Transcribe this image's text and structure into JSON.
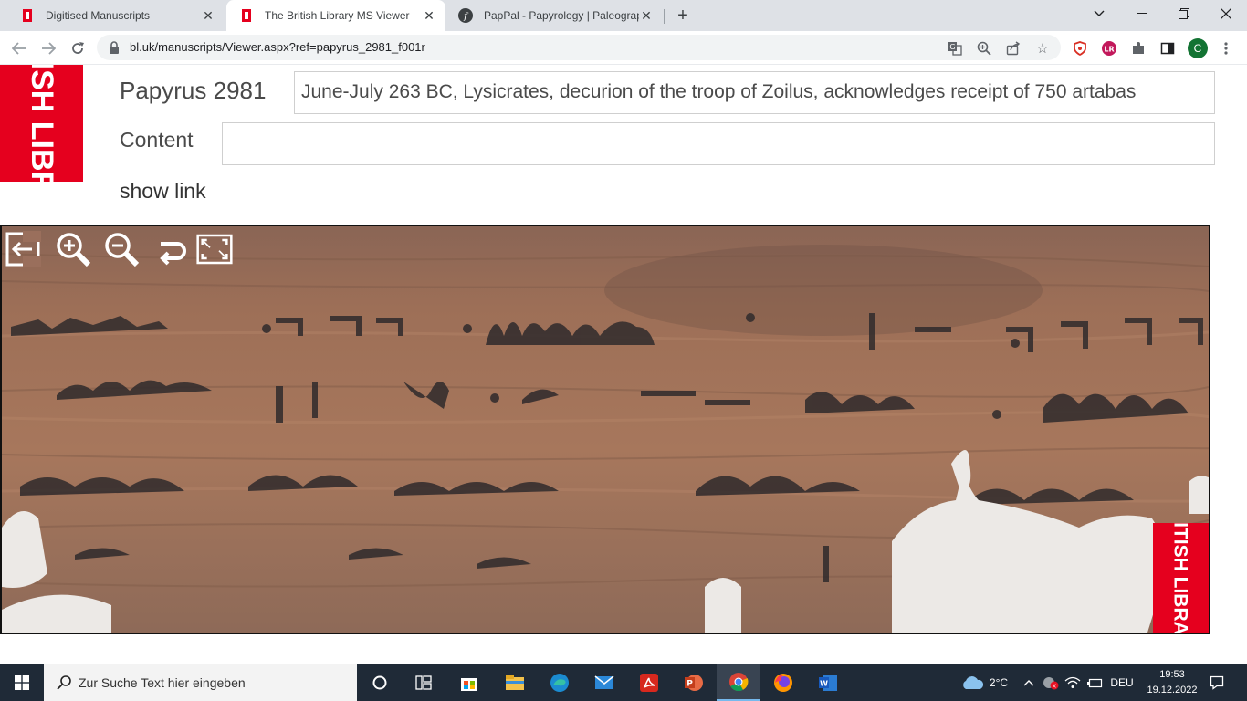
{
  "browser": {
    "tabs": [
      {
        "label": "Digitised Manuscripts",
        "icon": "british-library-favicon"
      },
      {
        "label": "The British Library MS Viewer",
        "icon": "british-library-favicon",
        "active": true
      },
      {
        "label": "PapPal - Papyrology | Paleograph",
        "icon": "pappal-favicon"
      }
    ],
    "url": "bl.uk/manuscripts/Viewer.aspx?ref=papyrus_2981_f001r",
    "profile_initial": "C"
  },
  "page": {
    "logo_text": "BRITISH LIBRARY",
    "manuscript_title": "Papyrus 2981",
    "description": "June-July 263 BC, Lysicrates, decurion of the troop of Zoilus, acknowledges receipt of 750 artabas",
    "content_label": "Content",
    "content_value": "",
    "show_link": "show link",
    "viewer": {
      "tools": [
        "exit-viewer-icon",
        "zoom-in-icon",
        "zoom-out-icon",
        "rotate-icon",
        "fullscreen-icon"
      ],
      "corner_logo_text": "BRITISH LIBRARY"
    }
  },
  "taskbar": {
    "search_placeholder": "Zur Suche Text hier eingeben",
    "weather": "2°C",
    "language": "DEU",
    "time": "19:53",
    "date": "19.12.2022"
  },
  "colors": {
    "bl_red": "#e5001e",
    "papyrus": "#9c6e55",
    "taskbar": "#1f2a37"
  }
}
